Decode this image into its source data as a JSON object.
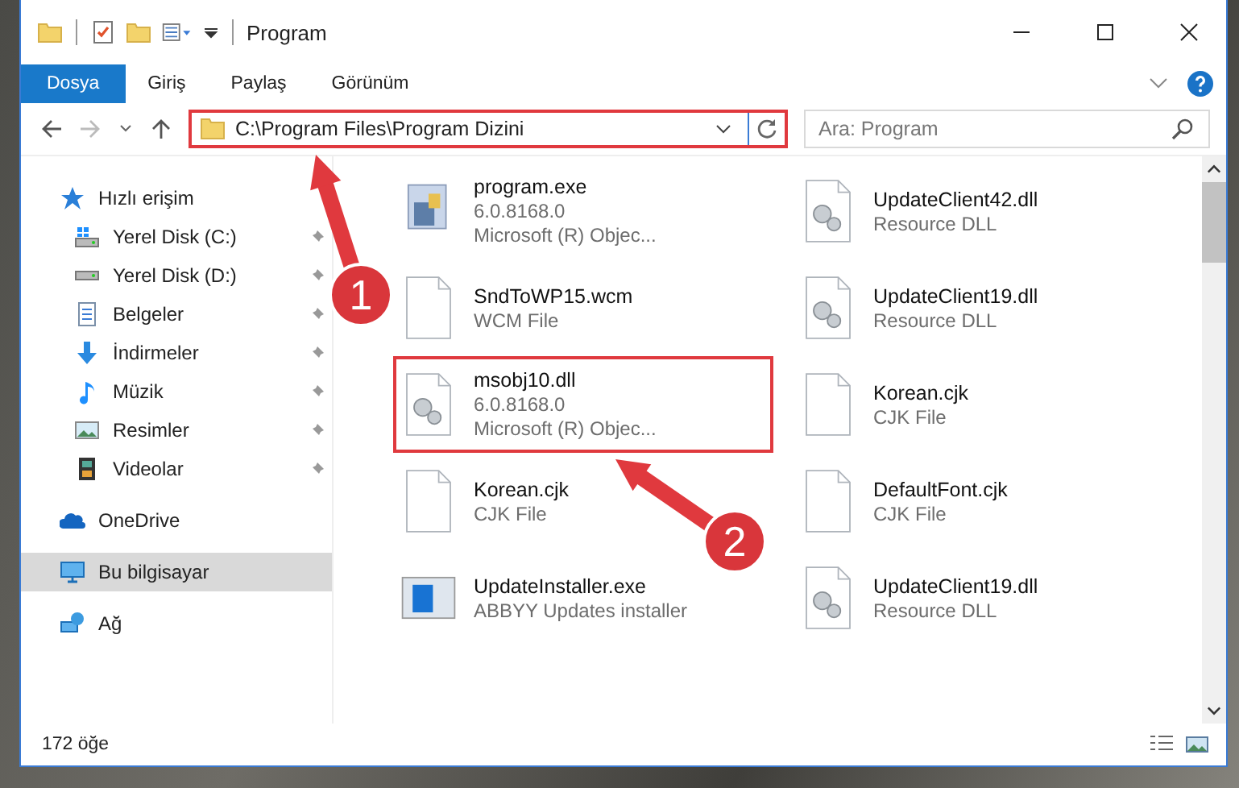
{
  "window": {
    "title": "Program"
  },
  "ribbon_tabs": [
    {
      "label": "Dosya",
      "selected": true
    },
    {
      "label": "Giriş",
      "selected": false
    },
    {
      "label": "Paylaş",
      "selected": false
    },
    {
      "label": "Görünüm",
      "selected": false
    }
  ],
  "address": {
    "path": "C:\\Program Files\\Program Dizini",
    "highlighted": true
  },
  "search": {
    "placeholder": "Ara: Program"
  },
  "sidebar": {
    "items": [
      {
        "label": "Hızlı erişim",
        "selected": false,
        "children": [
          {
            "label": "Yerel Disk (C:)",
            "pinned": true
          },
          {
            "label": "Yerel Disk (D:)",
            "pinned": true
          },
          {
            "label": "Belgeler",
            "pinned": true
          },
          {
            "label": "İndirmeler",
            "pinned": true
          },
          {
            "label": "Müzik",
            "pinned": true
          },
          {
            "label": "Resimler",
            "pinned": true
          },
          {
            "label": "Videolar",
            "pinned": true
          }
        ]
      },
      {
        "label": "OneDrive",
        "selected": false
      },
      {
        "label": "Bu bilgisayar",
        "selected": true
      },
      {
        "label": "Ağ",
        "selected": false
      }
    ]
  },
  "files": [
    {
      "name": "program.exe",
      "details": [
        "6.0.8168.0",
        "Microsoft (R) Objec..."
      ],
      "kind": "app",
      "highlighted": false
    },
    {
      "name": "UpdateClient42.dll",
      "details": [
        "Resource DLL"
      ],
      "kind": "gear",
      "highlighted": false
    },
    {
      "name": "SndToWP15.wcm",
      "details": [
        "WCM File"
      ],
      "kind": "blank",
      "highlighted": false
    },
    {
      "name": "UpdateClient19.dll",
      "details": [
        "Resource DLL"
      ],
      "kind": "gear",
      "highlighted": false
    },
    {
      "name": "msobj10.dll",
      "details": [
        "6.0.8168.0",
        "Microsoft (R) Objec..."
      ],
      "kind": "gear",
      "highlighted": true
    },
    {
      "name": "Korean.cjk",
      "details": [
        "CJK File"
      ],
      "kind": "blank",
      "highlighted": false
    },
    {
      "name": "Korean.cjk",
      "details": [
        "CJK File"
      ],
      "kind": "blank",
      "highlighted": false
    },
    {
      "name": "DefaultFont.cjk",
      "details": [
        "CJK File"
      ],
      "kind": "blank",
      "highlighted": false
    },
    {
      "name": "UpdateInstaller.exe",
      "details": [
        "ABBYY Updates installer"
      ],
      "kind": "installer",
      "highlighted": false
    },
    {
      "name": "UpdateClient19.dll",
      "details": [
        "Resource DLL"
      ],
      "kind": "gear",
      "highlighted": false
    }
  ],
  "status_bar": {
    "count": "172 öğe"
  },
  "callouts": [
    {
      "number": "1"
    },
    {
      "number": "2"
    }
  ]
}
